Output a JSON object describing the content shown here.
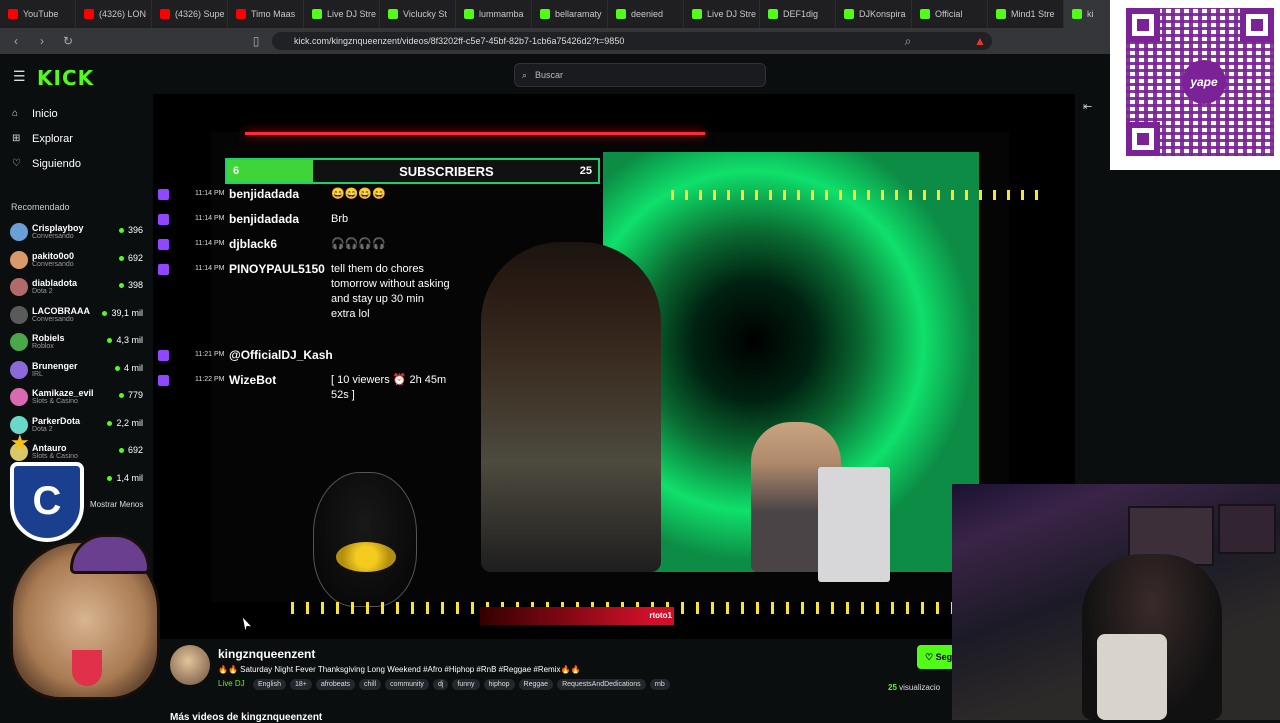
{
  "browser": {
    "tabs": [
      {
        "title": "YouTube",
        "color": "#ff0000"
      },
      {
        "title": "(4326) LON",
        "color": "#ff0000"
      },
      {
        "title": "(4326) Supe",
        "color": "#ff0000"
      },
      {
        "title": "Timo Maas",
        "color": "#ff0000"
      },
      {
        "title": "Live DJ Stre",
        "color": "#53fc18"
      },
      {
        "title": "Viclucky St",
        "color": "#53fc18"
      },
      {
        "title": "lummamba",
        "color": "#53fc18"
      },
      {
        "title": "bellaramaty",
        "color": "#53fc18"
      },
      {
        "title": "deenied",
        "color": "#53fc18"
      },
      {
        "title": "Live DJ Stre",
        "color": "#53fc18"
      },
      {
        "title": "DEF1dig",
        "color": "#53fc18"
      },
      {
        "title": "DJKonspira",
        "color": "#53fc18"
      },
      {
        "title": "Official",
        "color": "#53fc18"
      },
      {
        "title": "Mind1 Stre",
        "color": "#53fc18"
      },
      {
        "title": "ki",
        "color": "#53fc18"
      }
    ],
    "url": "kick.com/kingznqueenzent/videos/8f3202ff-c5e7-45bf-82b7-1cb6a75426d2?t=9850"
  },
  "header": {
    "logo": "KICK",
    "search_placeholder": "Buscar"
  },
  "sidebar": {
    "nav": [
      {
        "label": "Inicio",
        "icon": "home-icon",
        "glyph": "⌂"
      },
      {
        "label": "Explorar",
        "icon": "compass-icon",
        "glyph": "⊞"
      },
      {
        "label": "Siguiendo",
        "icon": "heart-icon",
        "glyph": "♡"
      }
    ],
    "section_title": "Recomendado",
    "channels": [
      {
        "name": "Crisplayboy",
        "category": "Conversando",
        "viewers": "396",
        "color": "#6a9fd8"
      },
      {
        "name": "pakito0o0",
        "category": "Conversando",
        "viewers": "692",
        "color": "#d89a6a"
      },
      {
        "name": "diabladota",
        "category": "Dota 2",
        "viewers": "398",
        "color": "#b06a6a"
      },
      {
        "name": "LACOBRAAA",
        "category": "Conversando",
        "viewers": "39,1 mil",
        "color": "#5a5a5a"
      },
      {
        "name": "Robiels",
        "category": "Roblox",
        "viewers": "4,3 mil",
        "color": "#4aa84a"
      },
      {
        "name": "Brunenger",
        "category": "IRL",
        "viewers": "4 mil",
        "color": "#8a6ad8"
      },
      {
        "name": "Kamikaze_evil",
        "category": "Slots & Casino",
        "viewers": "779",
        "color": "#d86ab0"
      },
      {
        "name": "ParkerDota",
        "category": "Dota 2",
        "viewers": "2,2 mil",
        "color": "#6ad8c8"
      },
      {
        "name": "Antauro",
        "category": "Slots & Casino",
        "viewers": "692",
        "color": "#d8c86a"
      },
      {
        "name": "",
        "category": "",
        "viewers": "1,4 mil",
        "color": "#333333"
      }
    ],
    "show_less": "Mostrar Menos"
  },
  "player": {
    "sub_goal": {
      "current": "6",
      "label": "SUBSCRIBERS",
      "goal": "25",
      "progress": 0.24
    },
    "chat": [
      {
        "time": "11:14 PM",
        "user": "benjidadada",
        "message": "😄😄😄😄"
      },
      {
        "time": "11:14 PM",
        "user": "benjidadada",
        "message": "Brb"
      },
      {
        "time": "11:14 PM",
        "user": "djblack6",
        "message": "🎧🎧🎧🎧"
      },
      {
        "time": "11:14 PM",
        "user": "PINOYPAUL5150",
        "message": "tell them do chores tomorrow without asking and stay up 30 min extra lol"
      },
      {
        "time": "11:21 PM",
        "user": "@OfficialDJ_Kash",
        "message": ""
      },
      {
        "time": "11:22 PM",
        "user": "WizeBot",
        "message": "[ 10 viewers ⏰ 2h 45m 52s ]"
      }
    ],
    "lower_bar_text": "rtoto1"
  },
  "stream": {
    "channel": "kingznqueenzent",
    "title": "🔥🔥 Saturday Night Fever Thanksgiving Long Weekend #Afro #Hiphop #RnB #Reggae #Remix🔥🔥",
    "category": "Live DJ",
    "tags": [
      "English",
      "18+",
      "afrobeats",
      "chill",
      "community",
      "dj",
      "funny",
      "hiphop",
      "Reggae",
      "RequestsAndDedications",
      "rnb"
    ],
    "follow_label": "Seg",
    "views_count": "25",
    "views_label": "visualizacio",
    "more_videos": "Más videos de kingznqueenzent"
  },
  "overlay": {
    "qr_brand": "yape",
    "mascot_shield_letter": "C",
    "mascot_star": "★"
  },
  "colors": {
    "kick_green": "#53fc18",
    "twitch_purple": "#9146ff"
  }
}
